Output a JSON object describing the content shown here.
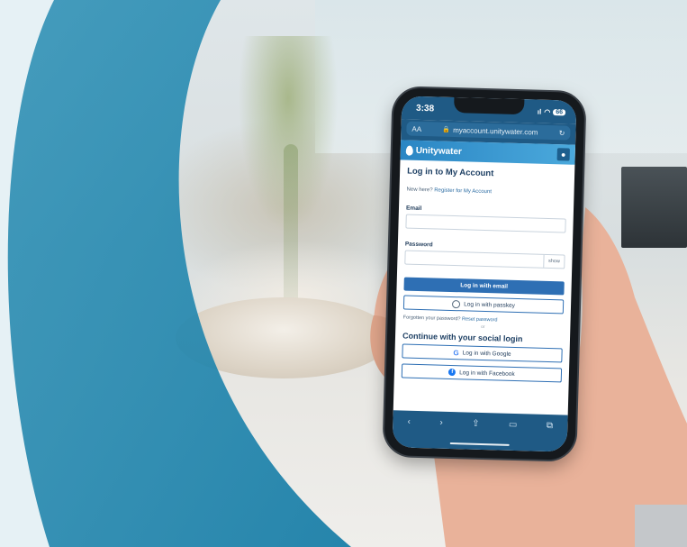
{
  "status_bar": {
    "time": "3:38",
    "signal": "ıl",
    "wifi": "◠",
    "battery": "66"
  },
  "browser": {
    "text_size": "AA",
    "url": "myaccount.unitywater.com",
    "reload_icon": "reload-icon"
  },
  "app": {
    "logo_text": "Unitywater",
    "user_icon": "user-icon"
  },
  "login": {
    "title": "Log in to My Account",
    "new_here": "New here?",
    "register_link": "Register for My Account",
    "email_label": "Email",
    "email_value": "",
    "password_label": "Password",
    "password_value": "",
    "show_label": "show",
    "email_button": "Log in with email",
    "passkey_button": "Log in with passkey",
    "forgot_text": "Forgotten your password?",
    "reset_link": "Reset password",
    "or_text": "or",
    "social_title": "Continue with your social login",
    "google_button": "Log in with Google",
    "google_glyph": "G",
    "facebook_button": "Log in with Facebook",
    "facebook_glyph": "f"
  },
  "toolbar": {
    "back": "‹",
    "forward": "›",
    "share": "⇪",
    "bookmarks": "▭",
    "tabs": "⧉"
  },
  "colors": {
    "accent": "#2e6fb4",
    "header": "#1f5a85",
    "curve": "#2b8fb3"
  }
}
